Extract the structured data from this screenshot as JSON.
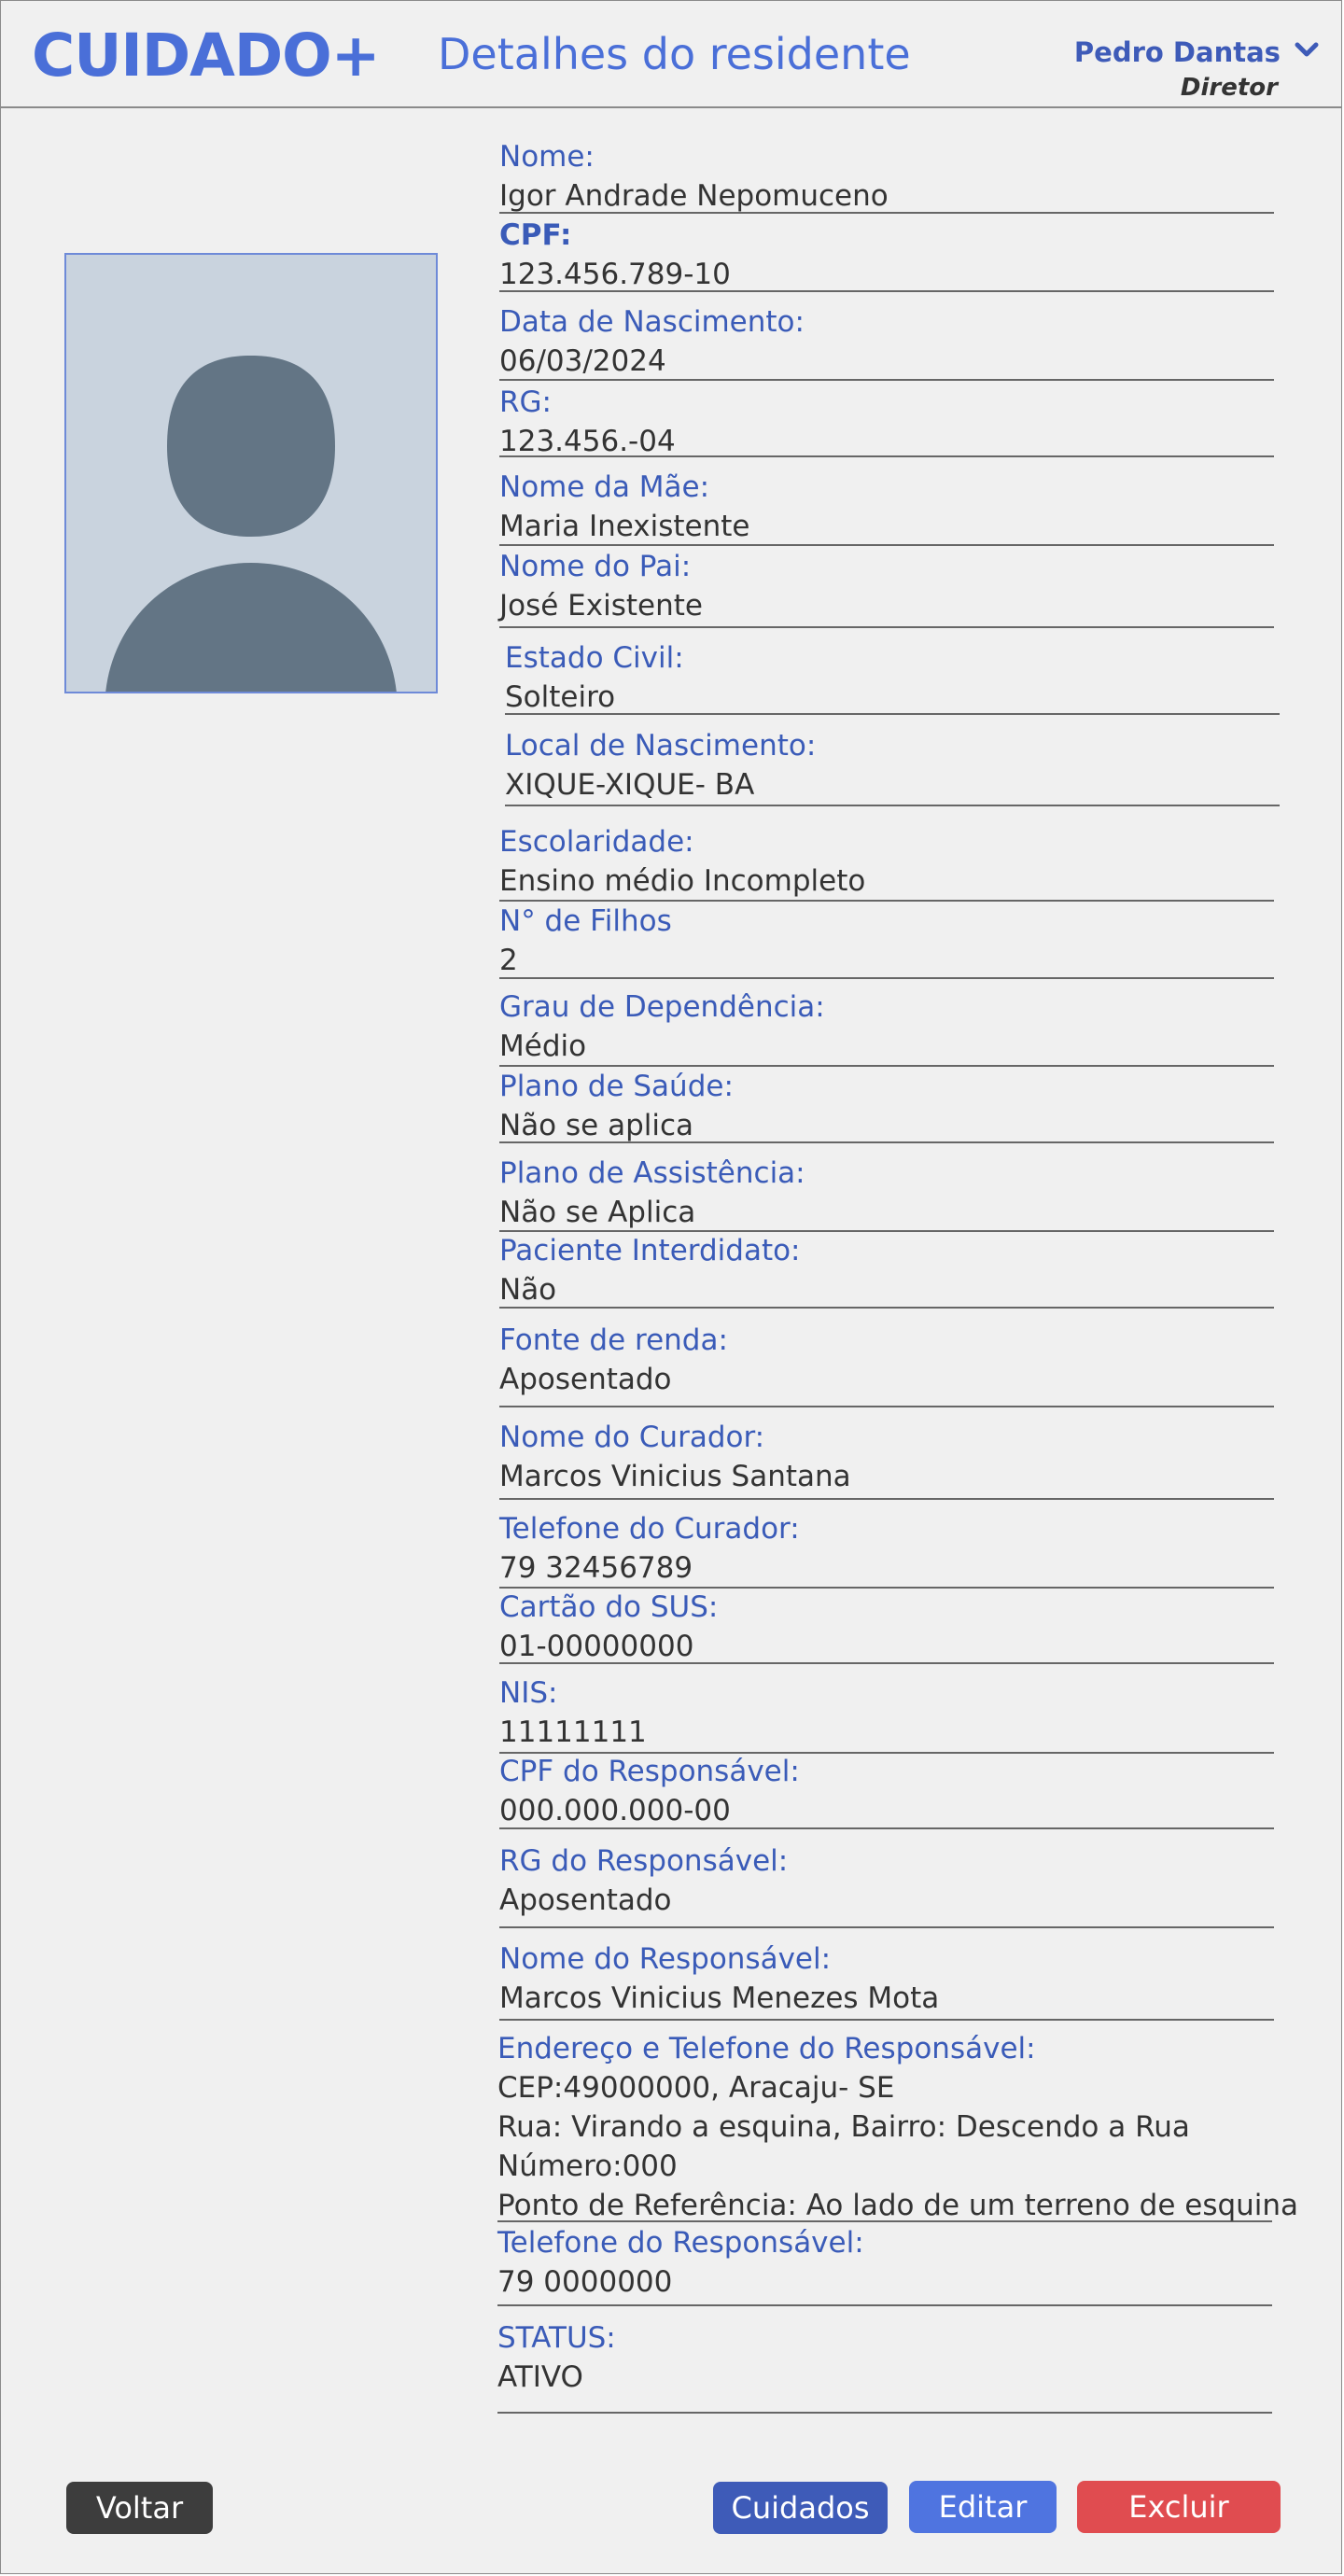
{
  "header": {
    "logo": "CUIDADO+",
    "title": "Detalhes do residente",
    "user_name": "Pedro Dantas",
    "user_role": "Diretor",
    "chevron_icon": "chevron-down-icon"
  },
  "photo": {
    "icon": "user-avatar-placeholder"
  },
  "fields": [
    {
      "label": "Nome:",
      "value": "Igor Andrade Nepomuceno"
    },
    {
      "label": "CPF:",
      "value": "123.456.789-10"
    },
    {
      "label": "Data de Nascimento:",
      "value": "06/03/2024"
    },
    {
      "label": "RG:",
      "value": "123.456.-04"
    },
    {
      "label": "Nome da Mãe:",
      "value": "Maria Inexistente"
    },
    {
      "label": "Nome do Pai:",
      "value": "José Existente"
    },
    {
      "label": "Estado Civil:",
      "value": "Solteiro"
    },
    {
      "label": "Local de Nascimento:",
      "value": "XIQUE-XIQUE- BA"
    },
    {
      "label": "Escolaridade:",
      "value": "Ensino médio Incompleto"
    },
    {
      "label": "N° de Filhos",
      "value": " 2"
    },
    {
      "label": "Grau de Dependência:",
      "value": "Médio"
    },
    {
      "label": "Plano de Saúde:",
      "value": "Não se aplica"
    },
    {
      "label": "Plano de Assistência:",
      "value": "Não se Aplica"
    },
    {
      "label": "Paciente Interdidato:",
      "value": "Não"
    },
    {
      "label": "Fonte de renda:",
      "value": "Aposentado"
    },
    {
      "label": "Nome do Curador:",
      "value": "Marcos Vinicius Santana"
    },
    {
      "label": "Telefone do Curador:",
      "value": "79 32456789"
    },
    {
      "label": "Cartão do SUS:",
      "value": "01-00000000"
    },
    {
      "label": "NIS:",
      "value": "11111111"
    },
    {
      "label": "CPF do Responsável:",
      "value": "000.000.000-00"
    },
    {
      "label": "RG do Responsável:",
      "value": "Aposentado"
    },
    {
      "label": "Nome do Responsável:",
      "value": "Marcos Vinicius Menezes Mota"
    }
  ],
  "address": {
    "label": "Endereço e Telefone do Responsável:",
    "line1": "CEP:49000000,  Aracaju- SE",
    "line2": "Rua: Virando a esquina, Bairro: Descendo a Rua",
    "line3": "Número:000",
    "line4": "Ponto de Referência: Ao lado de um terreno de esquina"
  },
  "phone": {
    "label": "Telefone do Responsável:",
    "value": "79 0000000"
  },
  "status": {
    "label": "STATUS:",
    "value": "ATIVO"
  },
  "buttons": {
    "back": "Voltar",
    "care": "Cuidados",
    "edit": "Editar",
    "delete": "Excluir"
  },
  "colors": {
    "accent": "#4a6fd8",
    "label": "#3a5bb8",
    "care_button": "#3e5bb8",
    "edit_button": "#4f74e0",
    "delete_button": "#e04c50",
    "back_button": "#3d3d3d"
  }
}
